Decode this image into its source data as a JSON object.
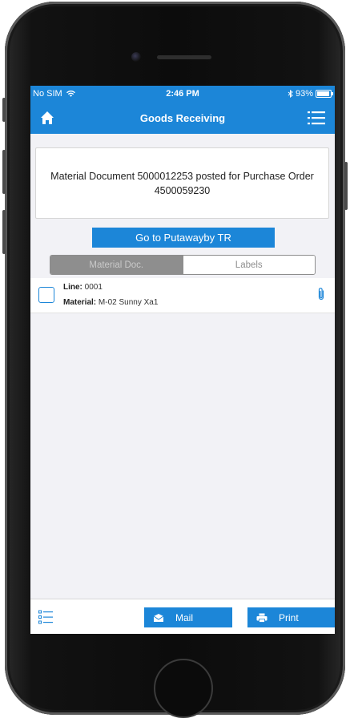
{
  "status_bar": {
    "carrier": "No SIM",
    "time": "2:46 PM",
    "battery": "93%"
  },
  "nav": {
    "title": "Goods Receiving",
    "home_icon": "home-icon",
    "menu_icon": "menu-icon"
  },
  "message": {
    "text": "Material Document 5000012253 posted for Purchase Order 4500059230"
  },
  "putaway_button": {
    "label": "Go to Putawayby TR"
  },
  "segment": {
    "tabs": [
      {
        "label": "Material Doc.",
        "active": true
      },
      {
        "label": "Labels",
        "active": false
      }
    ]
  },
  "rows": [
    {
      "line_label": "Line:",
      "line_value": "0001",
      "material_label": "Material:",
      "material_value": "M-02 Sunny Xa1"
    }
  ],
  "toolbar": {
    "mail_label": "Mail",
    "print_label": "Print"
  },
  "colors": {
    "accent": "#1c86d8",
    "background": "#f2f2f6"
  }
}
